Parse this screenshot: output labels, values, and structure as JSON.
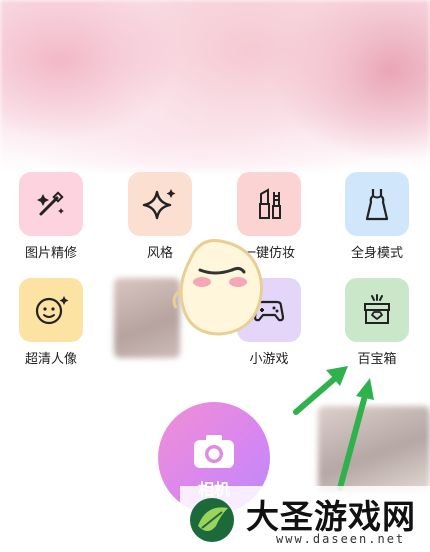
{
  "features": [
    {
      "name": "photo-edit",
      "label": "图片精修",
      "bg": "#fdd3e0",
      "icon": "magic-wand-icon"
    },
    {
      "name": "style",
      "label": "风格",
      "bg": "#fbe0d2",
      "icon": "sparkle-icon"
    },
    {
      "name": "one-click-makeup",
      "label": "一键仿妆",
      "bg": "#fbd3d3",
      "icon": "lipstick-icon"
    },
    {
      "name": "full-body-mode",
      "label": "全身模式",
      "bg": "#cfe6fb",
      "icon": "dress-icon"
    },
    {
      "name": "hd-portrait",
      "label": "超清人像",
      "bg": "#fce3a4",
      "icon": "smiley-face-icon"
    },
    {
      "name": "mini-games",
      "label": "小游戏",
      "bg": "#e3d6f9",
      "icon": "gamepad-icon"
    },
    {
      "name": "treasure-box",
      "label": "百宝箱",
      "bg": "#cbe7c9",
      "icon": "treasure-box-icon"
    }
  ],
  "camera": {
    "label": "相机",
    "icon": "camera-icon"
  },
  "arrow_color": "#2fb24c",
  "watermark": {
    "text": "大圣游戏网",
    "url": "www.daseen.net"
  }
}
